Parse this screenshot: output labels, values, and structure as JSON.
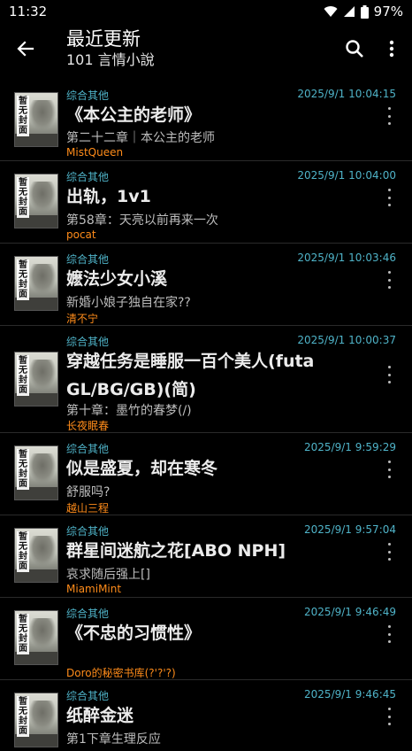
{
  "status": {
    "time": "11:32",
    "battery": "97%"
  },
  "appbar": {
    "title": "最近更新",
    "subtitle": "101 言情小說"
  },
  "cover_text": "暂无封面",
  "items": [
    {
      "category": "综合其他",
      "timestamp": "2025/9/1 10:04:15",
      "title": "《本公主的老师》",
      "chapter": "第二十二章｜本公主的老师",
      "author": "MistQueen"
    },
    {
      "category": "综合其他",
      "timestamp": "2025/9/1 10:04:00",
      "title": "出轨，1v1",
      "chapter": "第58章：天亮以前再来一次",
      "author": "pocat"
    },
    {
      "category": "综合其他",
      "timestamp": "2025/9/1 10:03:46",
      "title": "嬷法少女小溪",
      "chapter": "新婚小娘子独自在家??",
      "author": "清不宁"
    },
    {
      "category": "综合其他",
      "timestamp": "2025/9/1 10:00:37",
      "title": "穿越任务是睡服一百个美人(futa GL/BG/GB)(简)",
      "chapter": "第十章：墨竹的春梦(/)",
      "author": "长夜眠春"
    },
    {
      "category": "综合其他",
      "timestamp": "2025/9/1 9:59:29",
      "title": "似是盛夏，却在寒冬",
      "chapter": "舒服吗?",
      "author": "越山三程"
    },
    {
      "category": "综合其他",
      "timestamp": "2025/9/1 9:57:04",
      "title": "群星间迷航之花[ABO NPH]",
      "chapter": "哀求随后强上[]",
      "author": "MiamiMint"
    },
    {
      "category": "综合其他",
      "timestamp": "2025/9/1 9:46:49",
      "title": "《不忠的习惯性》",
      "chapter": "",
      "author": "Doro的秘密书库(?'?'?)"
    },
    {
      "category": "综合其他",
      "timestamp": "2025/9/1 9:46:45",
      "title": "纸醉金迷",
      "chapter": "第1下章生理反应",
      "author": ""
    }
  ]
}
